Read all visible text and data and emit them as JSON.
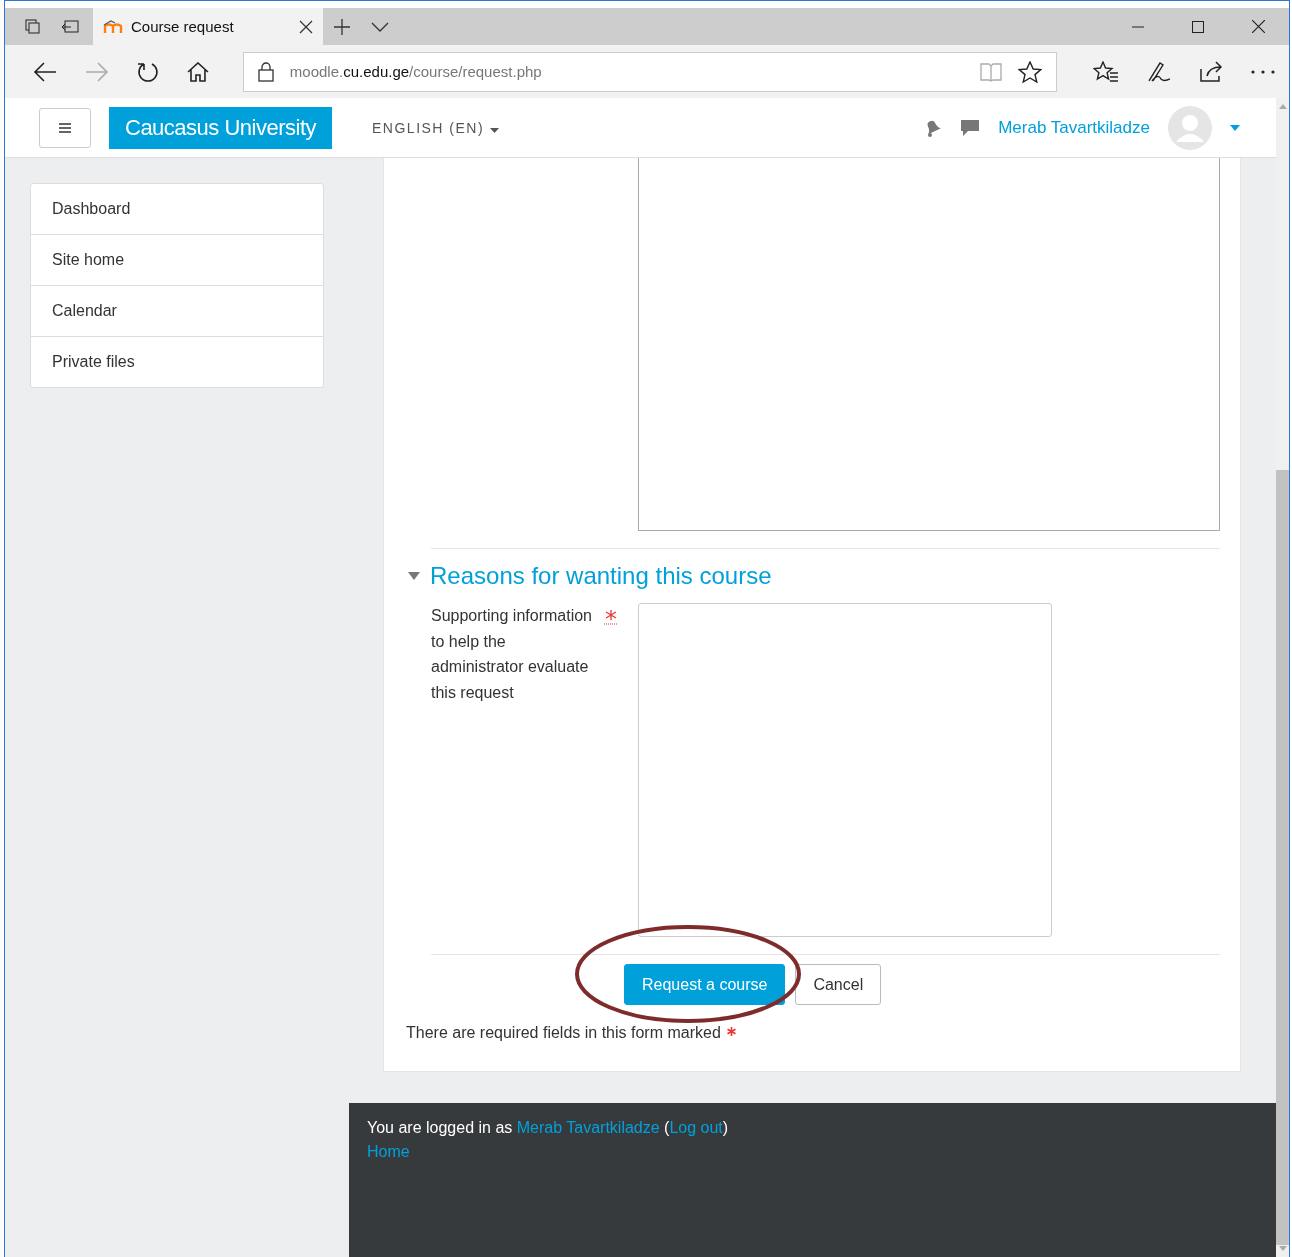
{
  "browser": {
    "tab_title": "Course request",
    "url_prefix": "moodle.",
    "url_domain": "cu.edu.ge",
    "url_path": "/course/request.php"
  },
  "navbar": {
    "brand": "Caucasus University",
    "language": "ENGLISH (EN)",
    "user_name": "Merab Tavartkiladze"
  },
  "sidebar": {
    "items": [
      {
        "label": "Dashboard"
      },
      {
        "label": "Site home"
      },
      {
        "label": "Calendar"
      },
      {
        "label": "Private files"
      }
    ]
  },
  "form": {
    "section": {
      "title": "Reasons for wanting this course",
      "expanded": true,
      "field_label": "Supporting information to help the administrator evaluate this request",
      "required": true
    },
    "buttons": [
      {
        "kind": "primary",
        "label": "Request a course"
      },
      {
        "kind": "secondary",
        "label": "Cancel"
      }
    ],
    "required_note": "There are required fields in this form marked"
  },
  "footer": {
    "logged_in_prefix": "You are logged in as",
    "user_name": "Merab Tavartkiladze",
    "paren_open": "(",
    "logout_label": "Log out",
    "paren_close": ")",
    "home_label": "Home"
  }
}
